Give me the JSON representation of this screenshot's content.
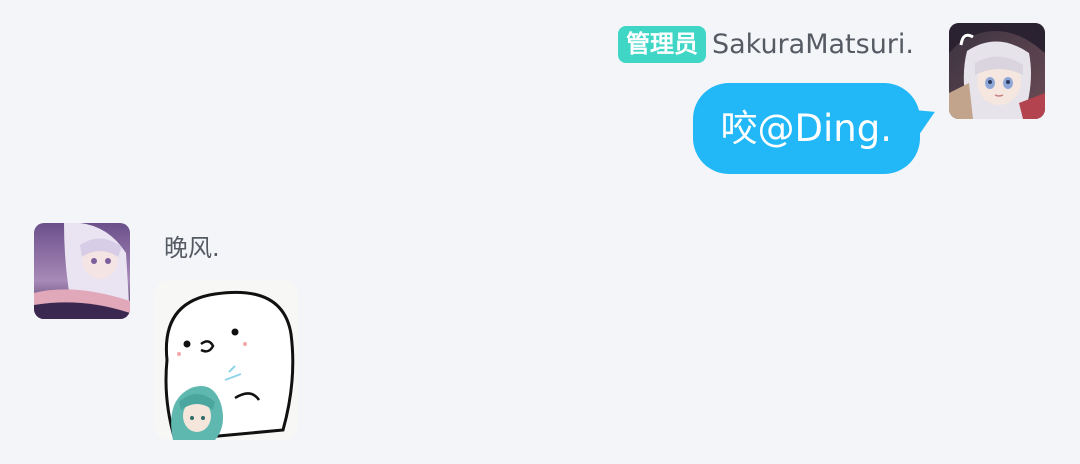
{
  "chat": {
    "outgoing": {
      "role_badge": "管理员",
      "sender": "SakuraMatsuri.",
      "text": "咬@Ding.",
      "bubble_color": "#22b8f7",
      "badge_color": "#3fd6c6"
    },
    "incoming": {
      "sender": "晚风.",
      "content_type": "sticker"
    }
  }
}
